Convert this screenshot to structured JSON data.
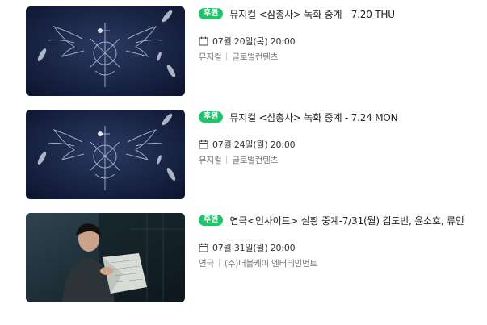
{
  "events": [
    {
      "badge": "후원",
      "title": "뮤지컬 <삼총사> 녹화 중계 - 7.20 THU",
      "date": "07월 20일(목) 20:00",
      "genre": "뮤지컬",
      "organizer": "글로벌컨텐츠",
      "thumbnail": "three-musketeers-crest-poster"
    },
    {
      "badge": "후원",
      "title": "뮤지컬 <삼총사> 녹화 중계 - 7.24 MON",
      "date": "07월 24일(월) 20:00",
      "genre": "뮤지컬",
      "organizer": "글로벌컨텐츠",
      "thumbnail": "three-musketeers-crest-poster"
    },
    {
      "badge": "후원",
      "title": "연극<인사이드> 실황 중계-7/31(월) 김도빈, 윤소호, 류인",
      "date": "07월 31일(월) 20:00",
      "genre": "연극",
      "organizer": "(주)더블케이 엔터테인먼트",
      "thumbnail": "inside-play-poster"
    }
  ],
  "colors": {
    "badge": "#1fc46a",
    "thumb_dark": "#16223f"
  },
  "icons": {
    "date": "calendar-icon"
  }
}
